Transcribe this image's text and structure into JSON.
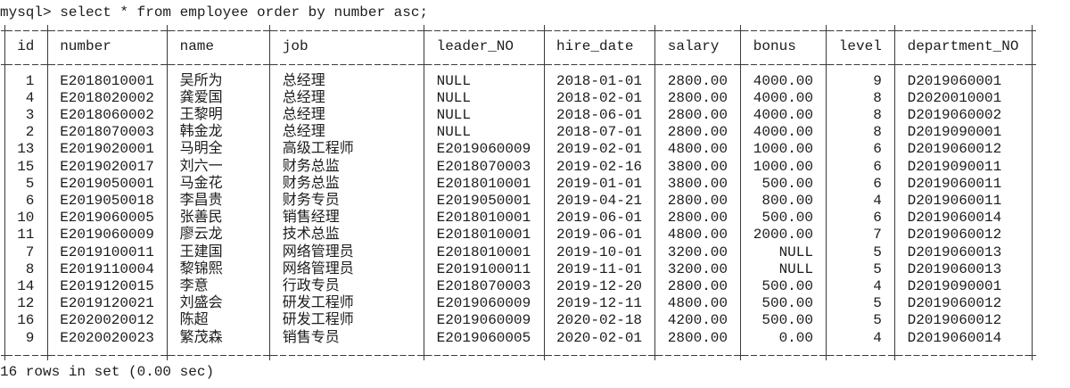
{
  "console": {
    "command_line": "mysql> select * from employee order by number asc;",
    "result_summary": "16 rows in set (0.00 sec)"
  },
  "columns": [
    "id",
    "number",
    "name",
    "job",
    "leader_NO",
    "hire_date",
    "salary",
    "bonus",
    "level",
    "department_NO"
  ],
  "rows": [
    {
      "id": "1",
      "number": "E2018010001",
      "name": "吴所为",
      "job": "总经理",
      "leader_NO": "NULL",
      "hire_date": "2018-01-01",
      "salary": "2800.00",
      "bonus": "4000.00",
      "level": "9",
      "department_NO": "D2019060001"
    },
    {
      "id": "4",
      "number": "E2018020002",
      "name": "龚爱国",
      "job": "总经理",
      "leader_NO": "NULL",
      "hire_date": "2018-02-01",
      "salary": "2800.00",
      "bonus": "4000.00",
      "level": "8",
      "department_NO": "D2020010001"
    },
    {
      "id": "3",
      "number": "E2018060002",
      "name": "王黎明",
      "job": "总经理",
      "leader_NO": "NULL",
      "hire_date": "2018-06-01",
      "salary": "2800.00",
      "bonus": "4000.00",
      "level": "8",
      "department_NO": "D2019060002"
    },
    {
      "id": "2",
      "number": "E2018070003",
      "name": "韩金龙",
      "job": "总经理",
      "leader_NO": "NULL",
      "hire_date": "2018-07-01",
      "salary": "2800.00",
      "bonus": "4000.00",
      "level": "8",
      "department_NO": "D2019090001"
    },
    {
      "id": "13",
      "number": "E2019020001",
      "name": "马明全",
      "job": "高级工程师",
      "leader_NO": "E2019060009",
      "hire_date": "2019-02-01",
      "salary": "4800.00",
      "bonus": "1000.00",
      "level": "6",
      "department_NO": "D2019060012"
    },
    {
      "id": "15",
      "number": "E2019020017",
      "name": "刘六一",
      "job": "财务总监",
      "leader_NO": "E2018070003",
      "hire_date": "2019-02-16",
      "salary": "3800.00",
      "bonus": "1000.00",
      "level": "6",
      "department_NO": "D2019090011"
    },
    {
      "id": "5",
      "number": "E2019050001",
      "name": "马金花",
      "job": "财务总监",
      "leader_NO": "E2018010001",
      "hire_date": "2019-01-01",
      "salary": "3800.00",
      "bonus": "500.00",
      "level": "6",
      "department_NO": "D2019060011"
    },
    {
      "id": "6",
      "number": "E2019050018",
      "name": "李昌贵",
      "job": "财务专员",
      "leader_NO": "E2019050001",
      "hire_date": "2019-04-21",
      "salary": "2800.00",
      "bonus": "800.00",
      "level": "4",
      "department_NO": "D2019060011"
    },
    {
      "id": "10",
      "number": "E2019060005",
      "name": "张善民",
      "job": "销售经理",
      "leader_NO": "E2018010001",
      "hire_date": "2019-06-01",
      "salary": "2800.00",
      "bonus": "500.00",
      "level": "6",
      "department_NO": "D2019060014"
    },
    {
      "id": "11",
      "number": "E2019060009",
      "name": "廖云龙",
      "job": "技术总监",
      "leader_NO": "E2018010001",
      "hire_date": "2019-06-01",
      "salary": "4800.00",
      "bonus": "2000.00",
      "level": "7",
      "department_NO": "D2019060012"
    },
    {
      "id": "7",
      "number": "E2019100011",
      "name": "王建国",
      "job": "网络管理员",
      "leader_NO": "E2018010001",
      "hire_date": "2019-10-01",
      "salary": "3200.00",
      "bonus": "NULL",
      "level": "5",
      "department_NO": "D2019060013"
    },
    {
      "id": "8",
      "number": "E2019110004",
      "name": "黎锦熙",
      "job": "网络管理员",
      "leader_NO": "E2019100011",
      "hire_date": "2019-11-01",
      "salary": "3200.00",
      "bonus": "NULL",
      "level": "5",
      "department_NO": "D2019060013"
    },
    {
      "id": "14",
      "number": "E2019120015",
      "name": "李意",
      "job": "行政专员",
      "leader_NO": "E2018070003",
      "hire_date": "2019-12-20",
      "salary": "2800.00",
      "bonus": "500.00",
      "level": "4",
      "department_NO": "D2019090001"
    },
    {
      "id": "12",
      "number": "E2019120021",
      "name": "刘盛会",
      "job": "研发工程师",
      "leader_NO": "E2019060009",
      "hire_date": "2019-12-11",
      "salary": "4800.00",
      "bonus": "500.00",
      "level": "5",
      "department_NO": "D2019060012"
    },
    {
      "id": "16",
      "number": "E2020020012",
      "name": "陈超",
      "job": "研发工程师",
      "leader_NO": "E2019060009",
      "hire_date": "2020-02-18",
      "salary": "4200.00",
      "bonus": "500.00",
      "level": "5",
      "department_NO": "D2019060012"
    },
    {
      "id": "9",
      "number": "E2020020023",
      "name": "繁茂森",
      "job": "销售专员",
      "leader_NO": "E2019060005",
      "hire_date": "2020-02-01",
      "salary": "2800.00",
      "bonus": "0.00",
      "level": "4",
      "department_NO": "D2019060014"
    }
  ]
}
